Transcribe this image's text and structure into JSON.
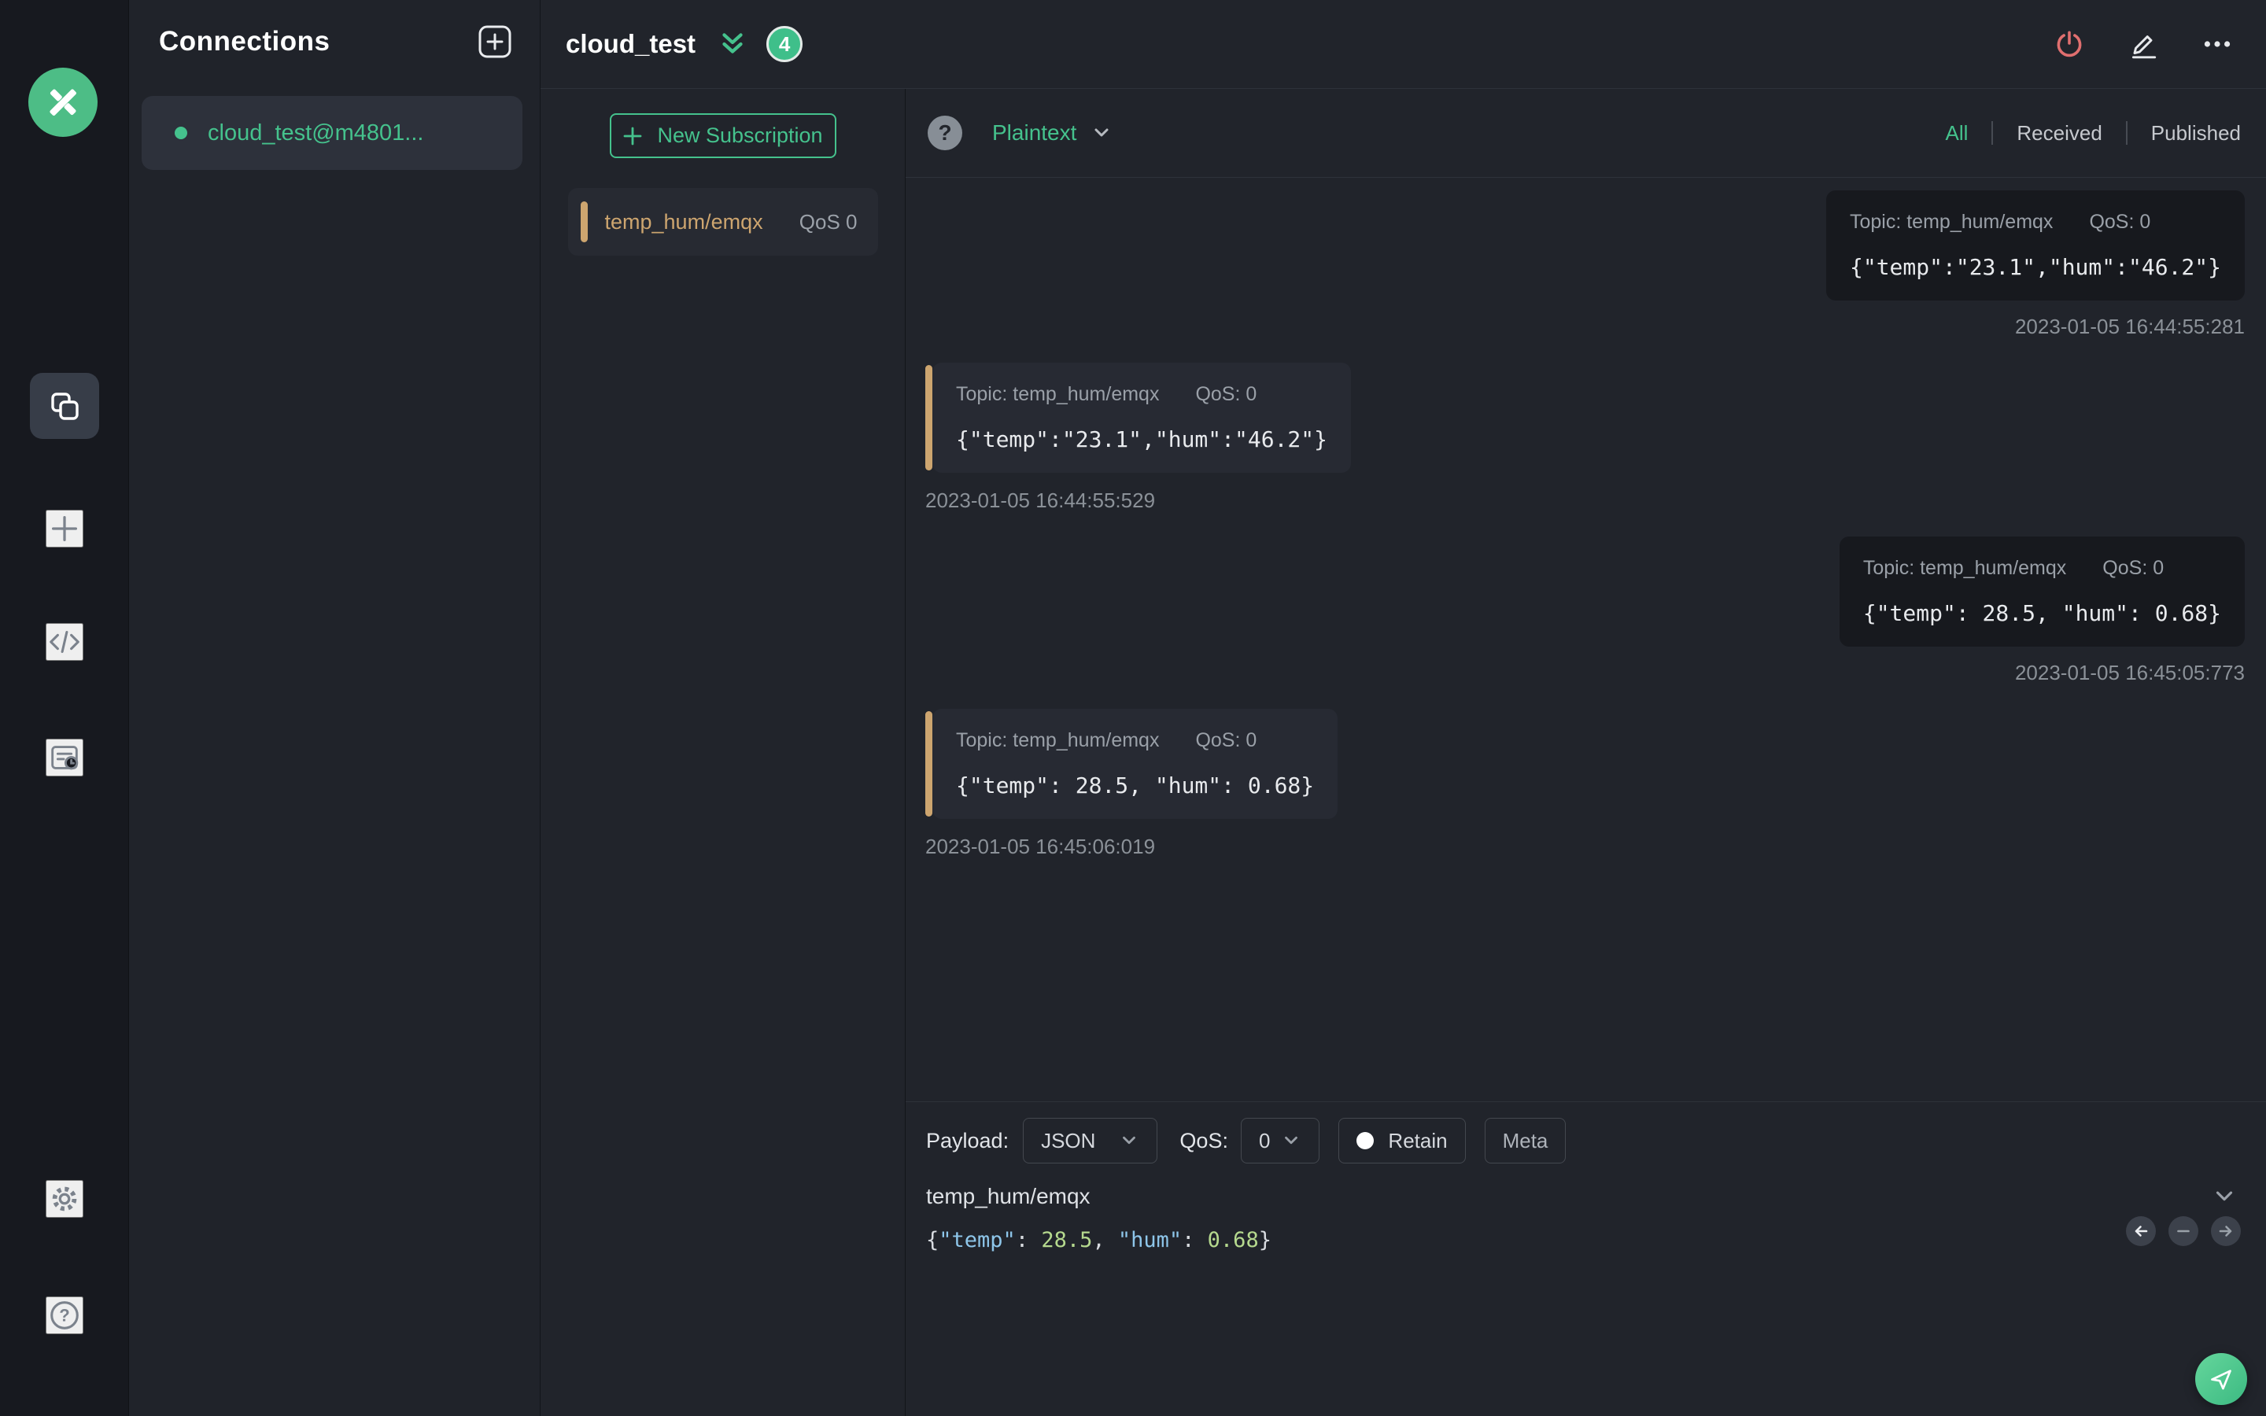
{
  "colors": {
    "accent_green": "#45c28d",
    "topic_tan": "#cda56f",
    "power_red": "#e06f6f",
    "badge_green": "#3fbf8a",
    "json_key_blue": "#8ec6ea",
    "json_number_green": "#b5d98e"
  },
  "connections": {
    "title": "Connections",
    "items": [
      {
        "label": "cloud_test@m4801..."
      }
    ]
  },
  "header": {
    "title": "cloud_test",
    "badge_count": "4"
  },
  "subscriptions": {
    "new_button_label": "New Subscription",
    "items": [
      {
        "topic": "temp_hum/emqx",
        "qos": "QoS 0"
      }
    ]
  },
  "viewbar": {
    "help": "?",
    "format": "Plaintext",
    "filters": [
      "All",
      "Received",
      "Published"
    ],
    "active_filter": "All"
  },
  "messages": [
    {
      "direction": "published",
      "topic": "Topic: temp_hum/emqx",
      "qos": "QoS: 0",
      "payload": "{\"temp\":\"23.1\",\"hum\":\"46.2\"}",
      "timestamp": "2023-01-05 16:44:55:281"
    },
    {
      "direction": "received",
      "topic": "Topic: temp_hum/emqx",
      "qos": "QoS: 0",
      "payload": "{\"temp\":\"23.1\",\"hum\":\"46.2\"}",
      "timestamp": "2023-01-05 16:44:55:529"
    },
    {
      "direction": "published",
      "topic": "Topic: temp_hum/emqx",
      "qos": "QoS: 0",
      "payload": "{\"temp\": 28.5, \"hum\": 0.68}",
      "timestamp": "2023-01-05 16:45:05:773"
    },
    {
      "direction": "received",
      "topic": "Topic: temp_hum/emqx",
      "qos": "QoS: 0",
      "payload": "{\"temp\": 28.5, \"hum\": 0.68}",
      "timestamp": "2023-01-05 16:45:06:019"
    }
  ],
  "publish": {
    "payload_label": "Payload:",
    "payload_format": "JSON",
    "qos_label": "QoS:",
    "qos_value": "0",
    "retain_label": "Retain",
    "meta_label": "Meta",
    "topic": "temp_hum/emqx",
    "editor_tokens": [
      {
        "text": "{",
        "type": "punct"
      },
      {
        "text": "\"temp\"",
        "type": "key"
      },
      {
        "text": ": ",
        "type": "punct"
      },
      {
        "text": "28.5",
        "type": "num"
      },
      {
        "text": ", ",
        "type": "punct"
      },
      {
        "text": "\"hum\"",
        "type": "key"
      },
      {
        "text": ": ",
        "type": "punct"
      },
      {
        "text": "0.68",
        "type": "num"
      },
      {
        "text": "}",
        "type": "punct"
      }
    ]
  }
}
